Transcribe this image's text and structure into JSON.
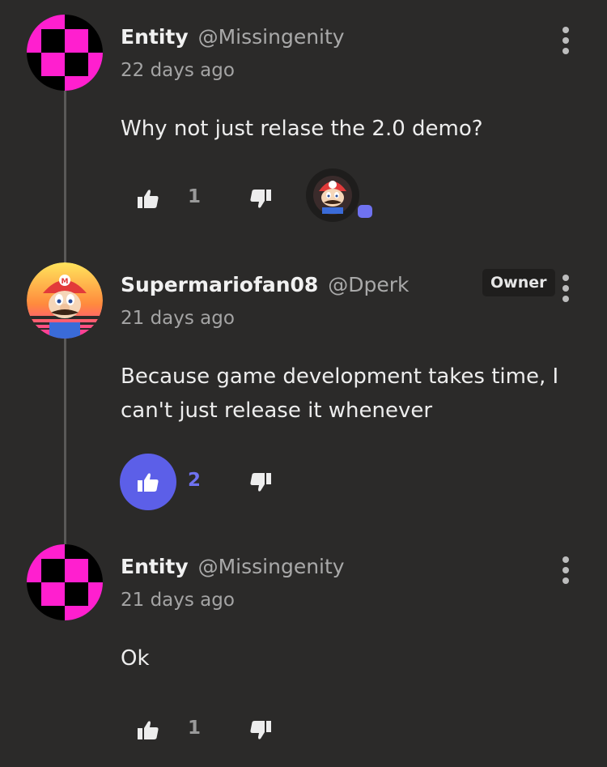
{
  "comments": [
    {
      "name": "Entity",
      "handle": "@Missingenity",
      "time": "22 days ago",
      "body": "Why not just relase the 2.0 demo?",
      "likes": "1",
      "liked": false
    },
    {
      "name": "Supermariofan08",
      "handle": "@Dperk",
      "badge": "Owner",
      "time": "21 days ago",
      "body": "Because game development takes time, I can't just release it whenever",
      "likes": "2",
      "liked": true
    },
    {
      "name": "Entity",
      "handle": "@Missingenity",
      "time": "21 days ago",
      "body": "Ok",
      "likes": "1",
      "liked": false
    }
  ],
  "icons": {
    "like": "thumbs-up-icon",
    "dislike": "thumbs-down-icon",
    "menu": "more-vertical-icon"
  },
  "colors": {
    "background": "#2b2a29",
    "accent": "#5c5fe8",
    "missing_texture_magenta": "#ff1fcf",
    "missing_texture_black": "#000000"
  }
}
